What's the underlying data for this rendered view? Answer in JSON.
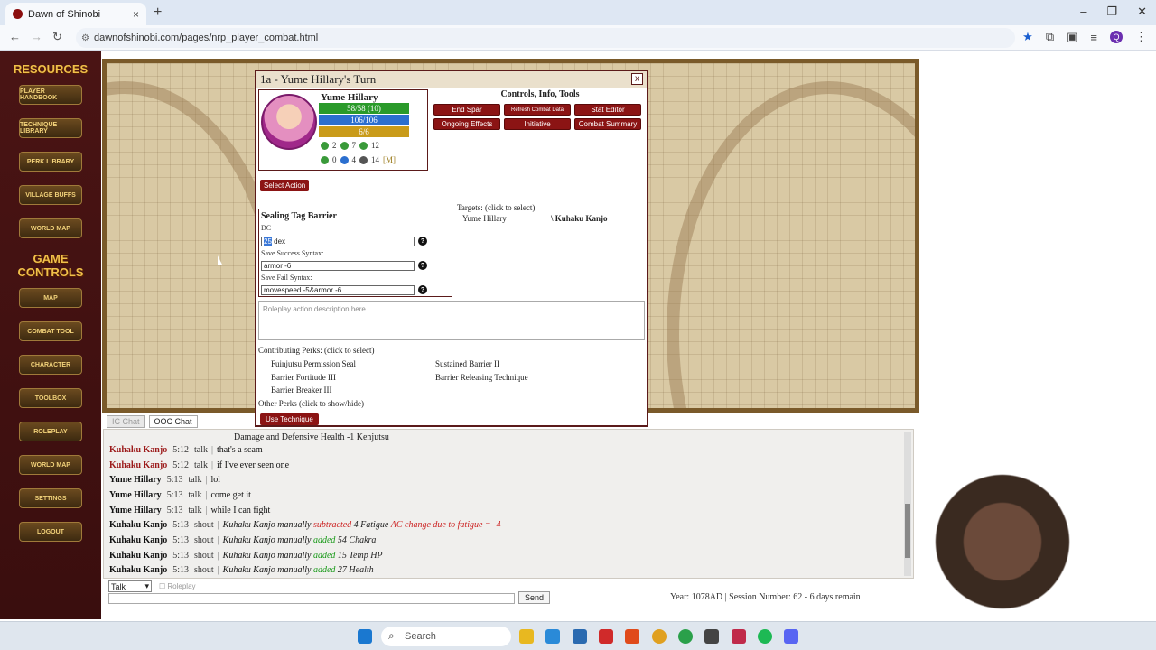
{
  "browser": {
    "tab_title": "Dawn of Shinobi",
    "url": "dawnofshinobi.com/pages/nrp_player_combat.html",
    "tab_close": "×",
    "new_tab": "+"
  },
  "sidebar": {
    "resources_title": "RESOURCES",
    "resources": [
      "Player Handbook",
      "Technique Library",
      "Perk Library",
      "Village Buffs",
      "World Map"
    ],
    "game_controls_title": "GAME CONTROLS",
    "controls": [
      "Map",
      "Combat Tool",
      "Character",
      "Toolbox",
      "Roleplay",
      "World Map",
      "Settings",
      "Logout"
    ]
  },
  "modal": {
    "title": "1a - Yume Hillary's Turn",
    "close": "x",
    "character": {
      "name": "Yume Hillary",
      "hp": "58/58 (10)",
      "chakra": "106/106",
      "stamina": "6/6",
      "stats_row1": [
        "2",
        "7",
        "12"
      ],
      "stats_row2": [
        "0",
        "4",
        "14",
        "[M]"
      ]
    },
    "controls_title": "Controls, Info, Tools",
    "controls": [
      "End Spar",
      "Refresh Combat Data",
      "Stat Editor",
      "Ongoing Effects",
      "Initiative",
      "Combat Summary"
    ],
    "select_action": "Select Action",
    "technique": {
      "name": "Sealing Tag Barrier",
      "dc_label": "DC",
      "dc_value": "25",
      "dc_suffix": "dex",
      "save_success_label": "Save Success Syntax:",
      "save_success_value": "armor -6",
      "save_fail_label": "Save Fail Syntax:",
      "save_fail_value": "movespeed -5&armor -6"
    },
    "targets_label": "Targets: (click to select)",
    "targets": [
      "Yume Hillary",
      "Kuhaku Kanjo"
    ],
    "rp_placeholder": "Roleplay action description here",
    "perks_label": "Contributing Perks: (click to select)",
    "perks": [
      "Fuinjutsu Permission Seal",
      "Sustained Barrier II",
      "Barrier Fortitude III",
      "Barrier Releasing Technique",
      "Barrier Breaker III"
    ],
    "other_perks": "Other Perks (click to show/hide)",
    "use_technique": "Use Technique"
  },
  "chat": {
    "tabs": [
      "IC Chat",
      "OOC Chat"
    ],
    "header": "Damage and Defensive Health -1 Kenjutsu",
    "messages": [
      {
        "who": "Kuhaku Kanjo",
        "time": "5:12",
        "kind": "talk",
        "text": "that's a scam"
      },
      {
        "who": "Kuhaku Kanjo",
        "time": "5:12",
        "kind": "talk",
        "text": "if I've ever seen one"
      },
      {
        "who": "Yume Hillary",
        "time": "5:13",
        "kind": "talk",
        "text": "lol"
      },
      {
        "who": "Yume Hillary",
        "time": "5:13",
        "kind": "talk",
        "text": "come get it"
      },
      {
        "who": "Yume Hillary",
        "time": "5:13",
        "kind": "talk",
        "text": "while I can fight"
      },
      {
        "who": "Kuhaku Kanjo",
        "time": "5:13",
        "kind": "shout",
        "a": "Kuhaku Kanjo manually",
        "b": "subtracted",
        "c": "4 Fatigue",
        "d": "AC change due to fatigue = -4"
      },
      {
        "who": "Kuhaku Kanjo",
        "time": "5:13",
        "kind": "shout",
        "a": "Kuhaku Kanjo manually",
        "b": "added",
        "c": "54 Chakra"
      },
      {
        "who": "Kuhaku Kanjo",
        "time": "5:13",
        "kind": "shout",
        "a": "Kuhaku Kanjo manually",
        "b": "added",
        "c": "15 Temp HP"
      },
      {
        "who": "Kuhaku Kanjo",
        "time": "5:13",
        "kind": "shout",
        "a": "Kuhaku Kanjo manually",
        "b": "added",
        "c": "27 Health"
      }
    ],
    "mode": "Talk",
    "roleplay_label": "Roleplay",
    "send": "Send",
    "session_info": "Year: 1078AD | Session Number: 62 - 6 days remain"
  },
  "taskbar": {
    "search": "Search"
  }
}
